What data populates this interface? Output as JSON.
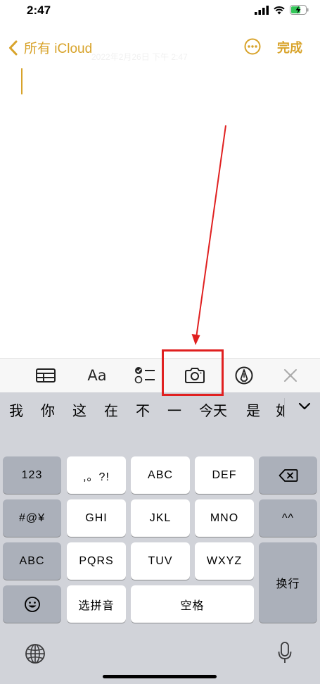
{
  "status": {
    "time": "2:47"
  },
  "nav": {
    "back_label": "所有 iCloud",
    "faint_date": "2022年2月26日 下午 2:47",
    "done_label": "完成"
  },
  "toolbar": {
    "font_label": "Aa"
  },
  "keyboard": {
    "candidates": [
      "我",
      "你",
      "这",
      "在",
      "不",
      "一",
      "今天",
      "是",
      "如"
    ],
    "row1": [
      "123",
      ",。?!",
      "ABC",
      "DEF"
    ],
    "row2": [
      "#@¥",
      "GHI",
      "JKL",
      "MNO",
      "^^"
    ],
    "row3": [
      "ABC",
      "PQRS",
      "TUV",
      "WXYZ"
    ],
    "return_label": "换行",
    "pinyin_label": "选拼音",
    "space_label": "空格"
  },
  "colors": {
    "accent": "#d8a32a",
    "highlight": "#e02020"
  },
  "icons": [
    "table-icon",
    "checklist-icon",
    "camera-icon",
    "markup-icon",
    "close-icon",
    "ellipsis-icon",
    "backspace-icon",
    "emoji-icon",
    "globe-icon",
    "mic-icon"
  ]
}
